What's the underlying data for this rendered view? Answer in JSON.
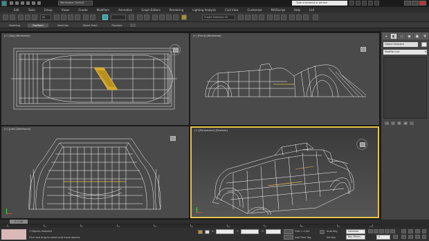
{
  "titlebar": {
    "workspace": "Workspace: Default",
    "search_placeholder": "Type a keyword or phrase"
  },
  "menubar": [
    "Edit",
    "Tools",
    "Group",
    "Views",
    "Create",
    "Modifiers",
    "Animation",
    "Graph Editors",
    "Rendering",
    "Lighting Analysis",
    "Civil View",
    "Customize",
    "MAXScript",
    "Help",
    "Lk4"
  ],
  "toolbar": {
    "selection_filter": "All",
    "named_selection": "Create Selection Se"
  },
  "ribbon": {
    "tabs": [
      "Modeling",
      "Freeform",
      "Selection",
      "Object Paint",
      "Populate"
    ],
    "selected_tab": "Freeform"
  },
  "viewports": {
    "top_label": "[+] [Top] [Wireframe]",
    "front_label": "[+] [Front] [Wireframe]",
    "left_label": "[+] [Left] [Wireframe]",
    "persp_label": "[+] [Perspective] [Realistic]"
  },
  "command_panel": {
    "tabs": [
      "+",
      "◧",
      "▭",
      "◉",
      "▣",
      "⚒"
    ],
    "object_name": "Object Selected",
    "modifier_list": "Modifier List",
    "stack_buttons": [
      "⊣",
      "|",
      "∀",
      "⊗",
      "⋮"
    ]
  },
  "timeline": {
    "frame_display": "0 / 100",
    "ticks": [
      "0",
      "10",
      "20",
      "30",
      "40",
      "50",
      "60",
      "70",
      "80",
      "90",
      "100"
    ]
  },
  "statusbar": {
    "selection_status": "1 Objects Selected",
    "prompt": "Click and drag to select and move objects",
    "x_label": "X:",
    "y_label": "Y:",
    "z_label": "Z:",
    "grid": "Grid = 0.0m",
    "add_time_tag": "Add Time Tag",
    "auto_key": "Auto Key",
    "set_key": "Set Key",
    "selected_dropdown": "Selected",
    "key_filters": "Key Filters...",
    "frame": "0"
  },
  "colors": {
    "active_viewport_border": "#e6c24a",
    "wire": "#ffffff",
    "highlight_edge": "#e6c24a"
  }
}
